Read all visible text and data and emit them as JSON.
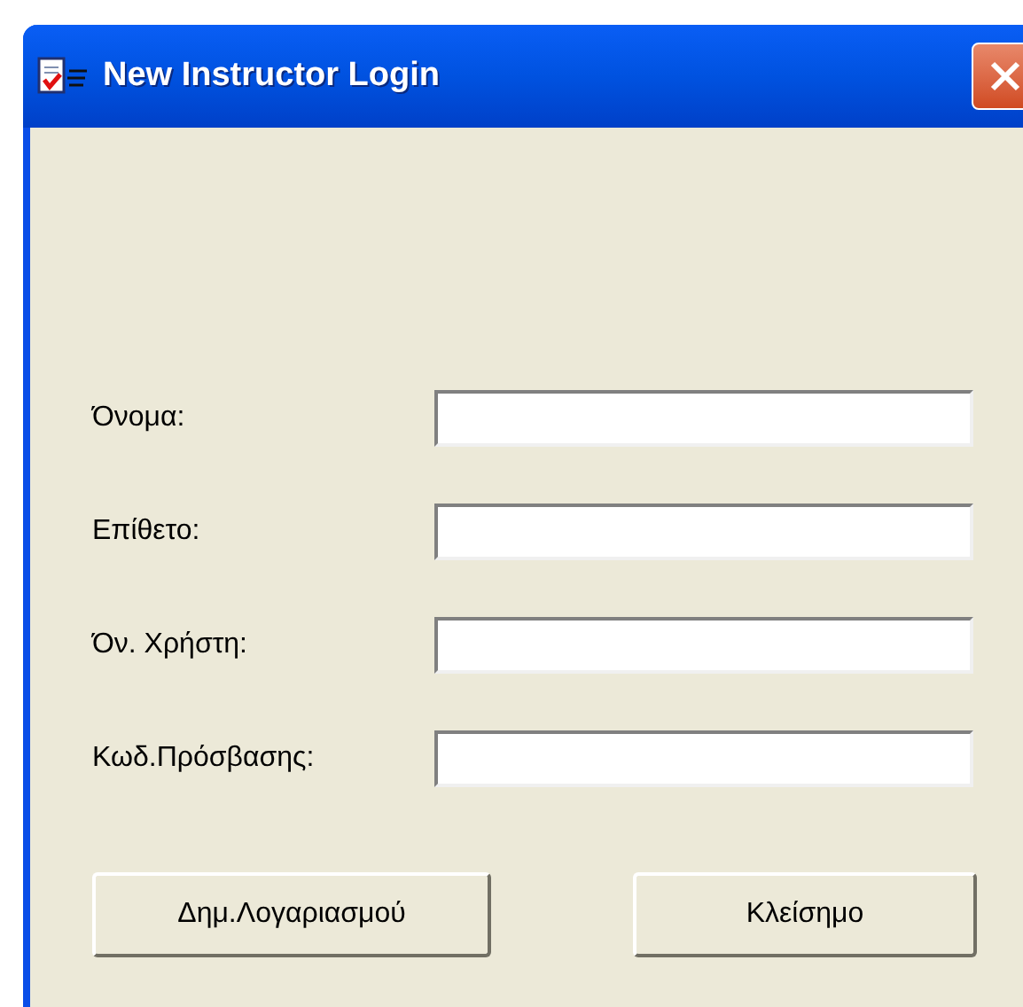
{
  "window": {
    "title": "New Instructor Login"
  },
  "fields": [
    {
      "label": "Όνομα:"
    },
    {
      "label": "Επίθετο:"
    },
    {
      "label": "Όν. Χρήστη:"
    },
    {
      "label": "Κωδ.Πρόσβασης:"
    }
  ],
  "buttons": [
    "Δημ.Λογαριασμού",
    "Κλείσημο"
  ]
}
